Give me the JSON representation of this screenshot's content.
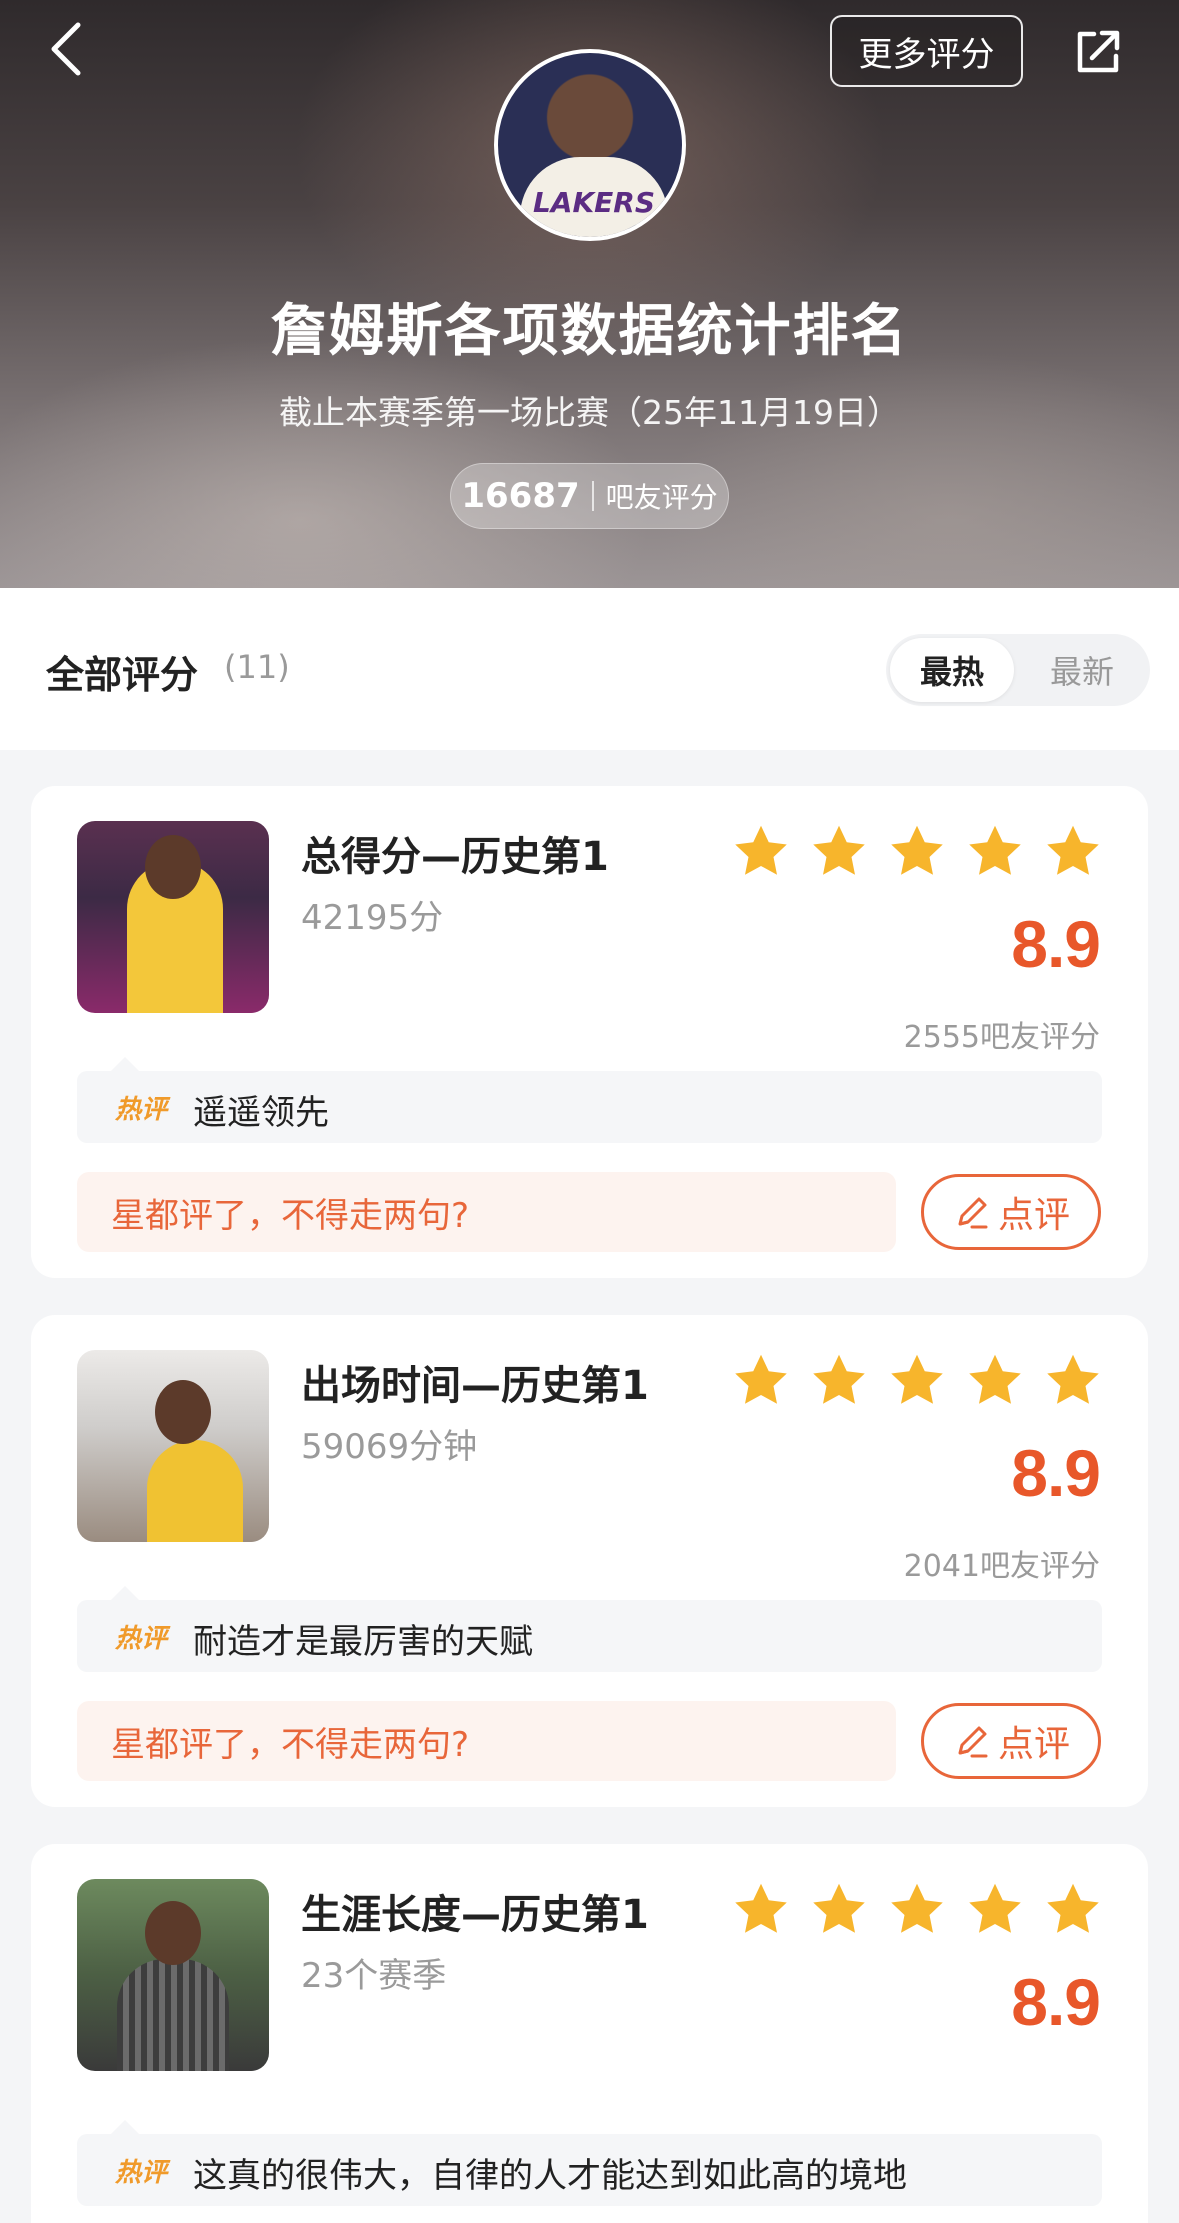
{
  "header": {
    "more_ratings_label": "更多评分",
    "title": "詹姆斯各项数据统计排名",
    "subtitle": "截止本赛季第一场比赛（25年11月19日）",
    "rating_count": "16687",
    "rating_count_label": "吧友评分",
    "avatar_jersey_text": "LAKERS"
  },
  "section": {
    "title": "全部评分",
    "count": "(11)",
    "sort_hot": "最热",
    "sort_new": "最新"
  },
  "colors": {
    "accent": "#e8572a",
    "star": "#f7b52c",
    "hot_tag": "#f09a2a"
  },
  "cards": [
    {
      "title": "总得分—历史第1",
      "value": "42195分",
      "score": "8.9",
      "raters": "2555吧友评分",
      "hot_tag": "热评",
      "hot_comment": "遥遥领先",
      "prompt": "星都评了，不得走两句?",
      "review_label": "点评",
      "stars": 5
    },
    {
      "title": "出场时间—历史第1",
      "value": "59069分钟",
      "score": "8.9",
      "raters": "2041吧友评分",
      "hot_tag": "热评",
      "hot_comment": "耐造才是最厉害的天赋",
      "prompt": "星都评了，不得走两句?",
      "review_label": "点评",
      "stars": 5
    },
    {
      "title": "生涯长度—历史第1",
      "value": "23个赛季",
      "score": "8.9",
      "hot_tag": "热评",
      "hot_comment": "这真的很伟大，自律的人才能达到如此高的境地",
      "stars": 5
    }
  ]
}
